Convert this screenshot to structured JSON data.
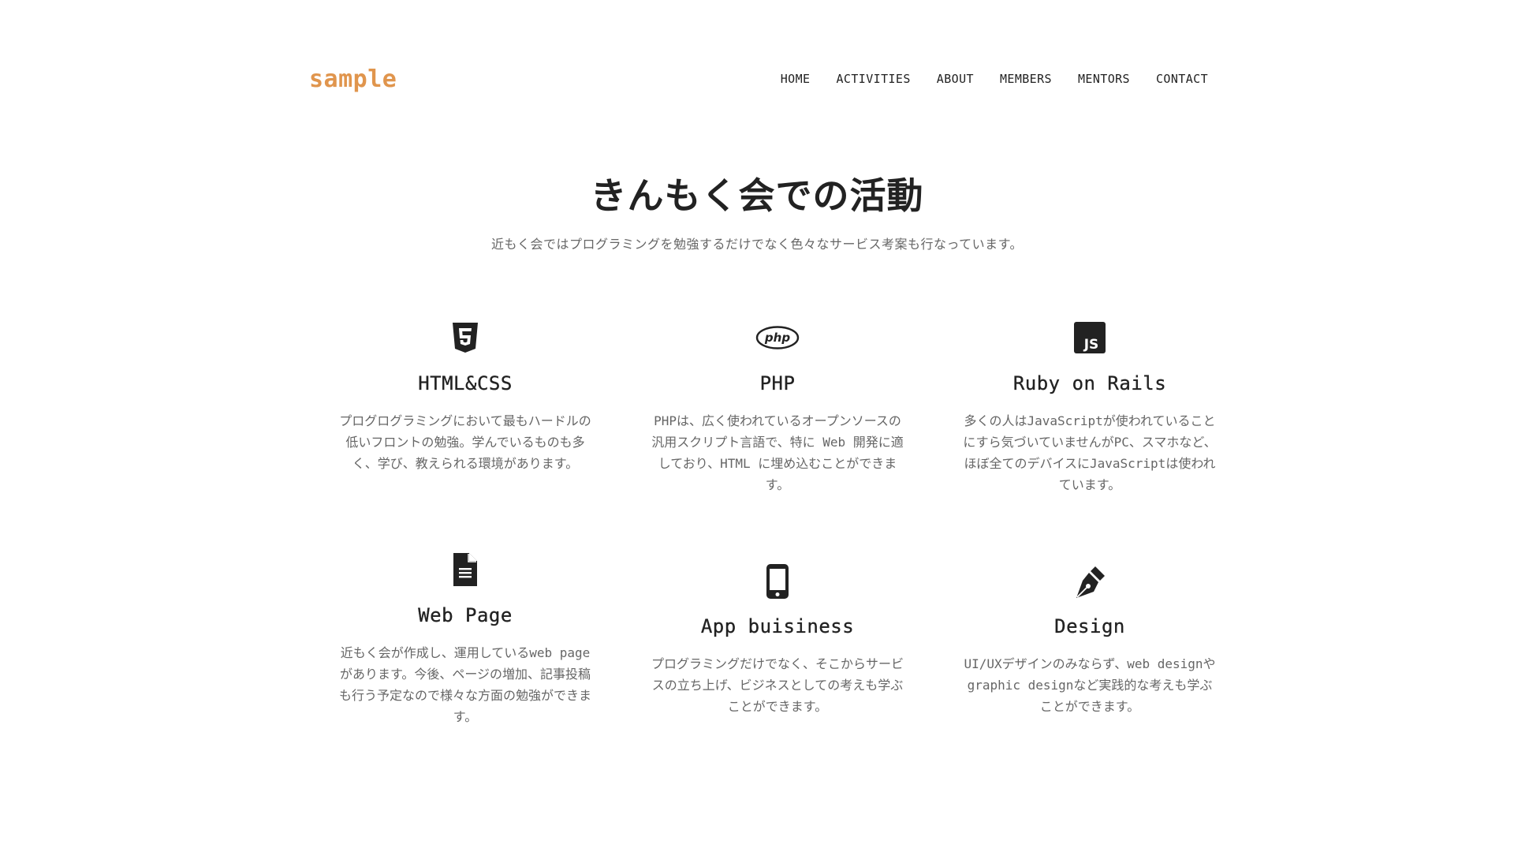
{
  "header": {
    "logo": "sample",
    "nav": [
      "HOME",
      "ACTIVITIES",
      "ABOUT",
      "MEMBERS",
      "MENTORS",
      "CONTACT"
    ]
  },
  "hero": {
    "title": "きんもく会での活動",
    "subtitle": "近もく会ではプログラミングを勉強するだけでなく色々なサービス考案も行なっています。"
  },
  "cards": [
    {
      "icon": "html5-icon",
      "title": "HTML&CSS",
      "text": "プログログラミングにおいて最もハードルの低いフロントの勉強。学んでいるものも多く、学び、教えられる環境があります。"
    },
    {
      "icon": "php-icon",
      "title": "PHP",
      "text": "PHPは、広く使われているオープンソースの汎用スクリプト言語で、特に Web 開発に適しており、HTML に埋め込むことができます。"
    },
    {
      "icon": "js-icon",
      "title": "Ruby on Rails",
      "text": "多くの人はJavaScriptが使われていることにすら気づいていませんがPC、スマホなど、ほぼ全てのデバイスにJavaScriptは使われています。"
    },
    {
      "icon": "document-icon",
      "title": "Web Page",
      "text": "近もく会が作成し、運用しているweb pageがあります。今後、ページの増加、記事投稿も行う予定なので様々な方面の勉強ができます。"
    },
    {
      "icon": "smartphone-icon",
      "title": "App buisiness",
      "text": "プログラミングだけでなく、そこからサービスの立ち上げ、ビジネスとしての考えも学ぶことができます。"
    },
    {
      "icon": "pen-nib-icon",
      "title": "Design",
      "text": "UI/UXデザインのみならず、web designやgraphic designなど実践的な考えも学ぶことができます。"
    }
  ]
}
